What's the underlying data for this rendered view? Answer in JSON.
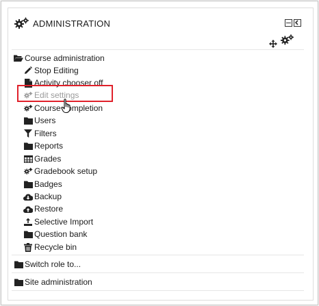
{
  "block": {
    "title": "ADMINISTRATION",
    "icons": {
      "header": "gears-icon",
      "hide": "minimize-icon",
      "dock": "dock-icon",
      "move": "move-icon",
      "actions": "actions-gear-icon"
    }
  },
  "course_admin": {
    "label": "Course administration",
    "items": [
      {
        "label": "Stop Editing",
        "icon": "pencil-icon"
      },
      {
        "label": "Activity chooser off",
        "icon": "file-icon"
      },
      {
        "label": "Edit settings",
        "icon": "gears-icon",
        "state": "disabled"
      },
      {
        "label": "Course completion",
        "icon": "gears-icon"
      },
      {
        "label": "Users",
        "icon": "folder-icon"
      },
      {
        "label": "Filters",
        "icon": "filter-icon"
      },
      {
        "label": "Reports",
        "icon": "folder-icon"
      },
      {
        "label": "Grades",
        "icon": "table-icon"
      },
      {
        "label": "Gradebook setup",
        "icon": "gears-icon"
      },
      {
        "label": "Badges",
        "icon": "folder-icon"
      },
      {
        "label": "Backup",
        "icon": "cloud-download-icon"
      },
      {
        "label": "Restore",
        "icon": "cloud-upload-icon"
      },
      {
        "label": "Selective Import",
        "icon": "upload-icon"
      },
      {
        "label": "Question bank",
        "icon": "folder-icon"
      },
      {
        "label": "Recycle bin",
        "icon": "trash-icon"
      }
    ]
  },
  "switch_role": {
    "label": "Switch role to..."
  },
  "site_admin": {
    "label": "Site administration"
  }
}
